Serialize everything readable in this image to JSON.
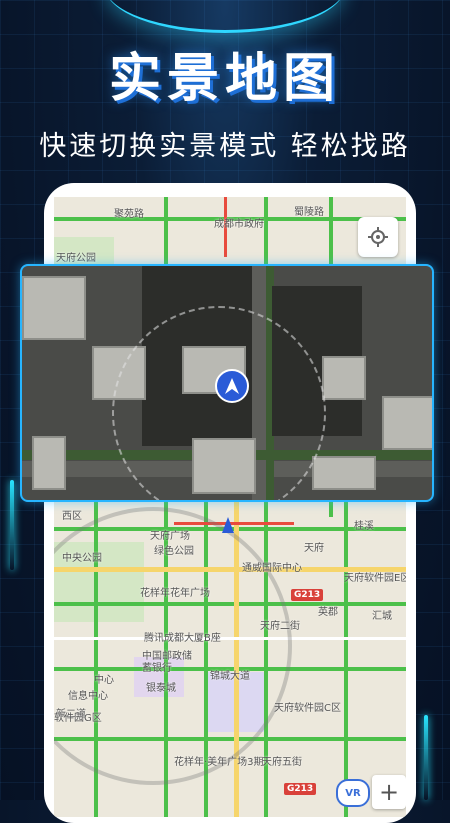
{
  "header": {
    "title": "实景地图",
    "subtitle": "快速切换实景模式 轻松找路"
  },
  "map": {
    "labels": [
      "聚苑路",
      "成都市政府",
      "蜀陵路",
      "天府公园",
      "西区",
      "天府广场",
      "天府立交",
      "绿色公园",
      "花样年花年广场",
      "通威国际中心",
      "腾讯成都大厦B座",
      "中国邮政储",
      "蓄银行",
      "银泰城",
      "天府二街",
      "天府",
      "软件园G区",
      "天府软件园C区",
      "花样年·美年广场3期",
      "天府五街",
      "英郡",
      "汇城",
      "天府软件园E区",
      "中心",
      "桂溪",
      "信息中心",
      "新二道",
      "中央公园",
      "锦城大道"
    ],
    "highway": "G213",
    "vr_label": "VR",
    "zoom_in": "+",
    "colors": {
      "road_green": "#4cc04a",
      "road_yellow": "#f6d56b",
      "road_red": "#e84b3d",
      "park": "#d4e7c5",
      "marker": "#2a5bd7",
      "accent": "#27b5ff"
    }
  },
  "icons": {
    "locate": "crosshair-icon",
    "navigation": "navigation-arrow-icon",
    "vr": "vr-icon",
    "zoom": "plus-icon"
  }
}
